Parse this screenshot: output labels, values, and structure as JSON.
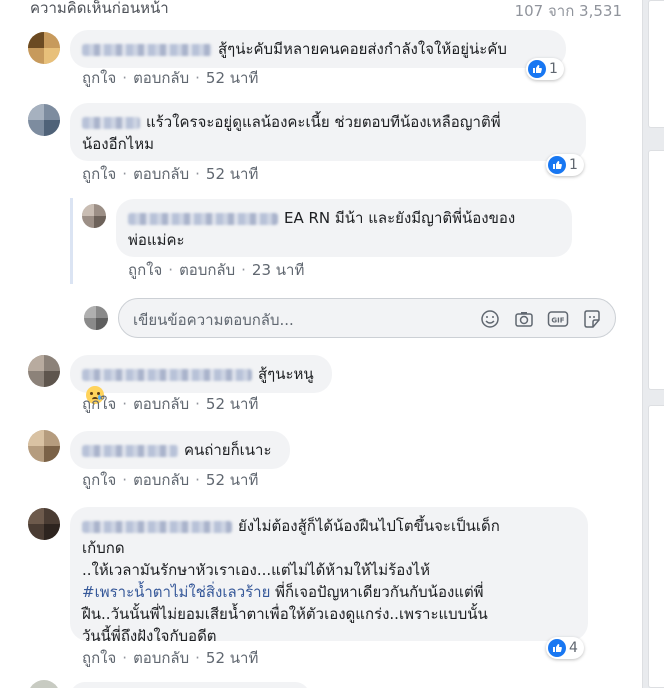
{
  "header": {
    "previous_comments_label": "ความคิดเห็นก่อนหน้า",
    "comment_count": "107 จาก 3,531"
  },
  "actions": {
    "like": "ถูกใจ",
    "reply": "ตอบกลับ",
    "separator": "·"
  },
  "comments": [
    {
      "text": "สู้ๆน่ะคับมีหลายคนคอยส่งกำลังใจให้อยู่น่ะคับ",
      "time": "52 นาที",
      "likes": "1"
    },
    {
      "text_line1": "แร้วใครจะอยู่ดูแลน้องคะเนี้ย ช่วยตอบทีน้องเหลือญาติพี่",
      "text_line2": "น้องอีกไหม",
      "time": "52 นาที",
      "likes": "1"
    },
    {
      "text": "สู้ๆนะหนู",
      "time": "52 นาที"
    },
    {
      "text": "คนถ่ายก็เนาะ",
      "time": "52 นาที"
    },
    {
      "line1": "ยังไม่ต้องสู้ก็ได้น้องฝืนไปโตขึ้นจะเป็นเด็ก",
      "line2": "เก้บกด",
      "line3": "..ให้เวลามันรักษาหัวเราเอง...แต่ไม่ได้ห้ามให้ไม่ร้องไห้",
      "hashtag": "#เพราะน้ำตาไม่ใช่สิ่งเลวร้าย",
      "line4_rest": " พี่ก็เจอปัญหาเดียวกันกับน้องแต่พี่",
      "line5": "ฝืน..วันนั้นพี่ไม่ยอมเสียน้ำตาเพื่อให้ตัวเองดูแกร่ง..เพราะแบบนั้น",
      "line6": "วันนี้พี่ถึงฝังใจกับอดีต",
      "time": "52 นาที",
      "likes": "4"
    }
  ],
  "reply": {
    "text_line1": "EA RN มีน้า และยังมีญาติพี่น้องของ",
    "text_line2": "พ่อแม่คะ",
    "time": "23 นาที"
  },
  "reply_input": {
    "placeholder": "เขียนข้อความตอบกลับ..."
  },
  "icons": [
    "like-icon",
    "smiley-icon",
    "camera-icon",
    "gif-icon",
    "sticker-icon",
    "sad-emoji-icon"
  ],
  "colors": {
    "like_blue": "#1877f2",
    "bubble_bg": "#f2f3f5",
    "hashtag": "#365899"
  }
}
